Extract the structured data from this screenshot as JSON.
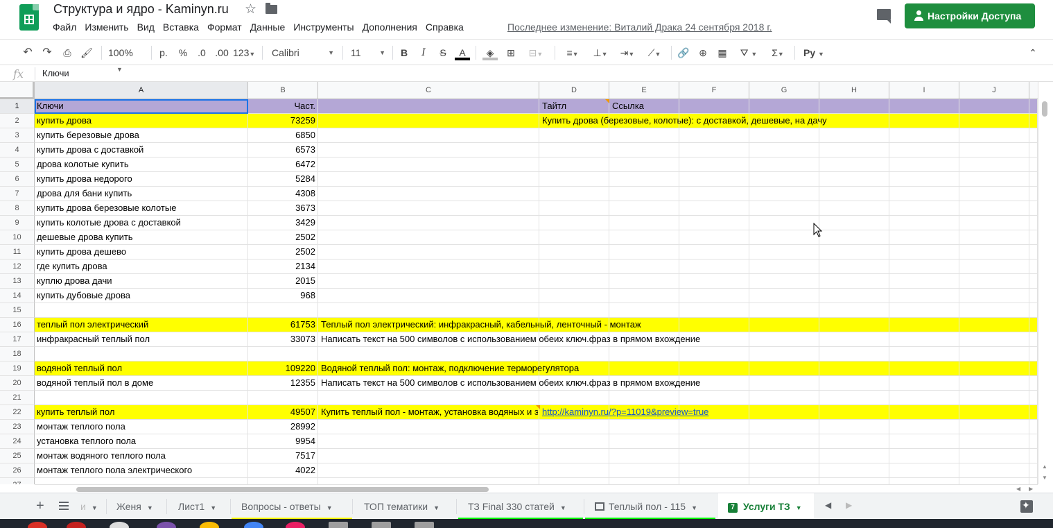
{
  "doc": {
    "title": "Структура и ядро - Kaminyn.ru",
    "last_edit": "Последнее изменение: Виталий Драка 24 сентября 2018 г.",
    "share_label": "Настройки Доступа"
  },
  "menu": [
    "Файл",
    "Изменить",
    "Вид",
    "Вставка",
    "Формат",
    "Данные",
    "Инструменты",
    "Дополнения",
    "Справка"
  ],
  "toolbar": {
    "zoom": "100%",
    "currency": "р.",
    "percent": "%",
    "dec_less": ".0",
    "dec_more": ".00",
    "more_formats": "123",
    "font": "Calibri",
    "font_size": "11",
    "bold": "B",
    "italic": "I",
    "strike": "S",
    "text_color": "A",
    "input_tools": "Pу",
    "text_color_value": "#000000",
    "fill_color_value": "#bdbdbd"
  },
  "formula": {
    "fx": "fx",
    "value": "Ключи"
  },
  "columns": [
    "A",
    "B",
    "C",
    "D",
    "E",
    "F",
    "G",
    "H",
    "I",
    "J"
  ],
  "rows": [
    {
      "n": "1",
      "style": "purple",
      "a": "Ключи",
      "b": "Част.",
      "c": "",
      "d": "Тайтл",
      "e": "Ссылка"
    },
    {
      "n": "2",
      "style": "yellow",
      "a": "купить дрова",
      "b": "73259",
      "c": "",
      "d": "Купить дрова (березовые, колотые): с доставкой, дешевые, на дачу",
      "e": ""
    },
    {
      "n": "3",
      "style": "",
      "a": "купить березовые дрова",
      "b": "6850",
      "c": "",
      "d": "",
      "e": ""
    },
    {
      "n": "4",
      "style": "",
      "a": "купить дрова с доставкой",
      "b": "6573",
      "c": "",
      "d": "",
      "e": ""
    },
    {
      "n": "5",
      "style": "",
      "a": "дрова колотые купить",
      "b": "6472",
      "c": "",
      "d": "",
      "e": ""
    },
    {
      "n": "6",
      "style": "",
      "a": "купить дрова недорого",
      "b": "5284",
      "c": "",
      "d": "",
      "e": ""
    },
    {
      "n": "7",
      "style": "",
      "a": "дрова для бани купить",
      "b": "4308",
      "c": "",
      "d": "",
      "e": ""
    },
    {
      "n": "8",
      "style": "",
      "a": "купить дрова березовые колотые",
      "b": "3673",
      "c": "",
      "d": "",
      "e": ""
    },
    {
      "n": "9",
      "style": "",
      "a": "купить колотые дрова с доставкой",
      "b": "3429",
      "c": "",
      "d": "",
      "e": ""
    },
    {
      "n": "10",
      "style": "",
      "a": "дешевые дрова купить",
      "b": "2502",
      "c": "",
      "d": "",
      "e": ""
    },
    {
      "n": "11",
      "style": "",
      "a": "купить дрова дешево",
      "b": "2502",
      "c": "",
      "d": "",
      "e": ""
    },
    {
      "n": "12",
      "style": "",
      "a": "где купить дрова",
      "b": "2134",
      "c": "",
      "d": "",
      "e": ""
    },
    {
      "n": "13",
      "style": "",
      "a": "куплю дрова дачи",
      "b": "2015",
      "c": "",
      "d": "",
      "e": ""
    },
    {
      "n": "14",
      "style": "",
      "a": "купить дубовые дрова",
      "b": "968",
      "c": "",
      "d": "",
      "e": ""
    },
    {
      "n": "15",
      "style": "",
      "a": "",
      "b": "",
      "c": "",
      "d": "",
      "e": ""
    },
    {
      "n": "16",
      "style": "yellow",
      "a": "теплый пол электрический",
      "b": "61753",
      "c": "Теплый пол электрический: инфракрасный, кабельный, ленточный - монтаж",
      "d": "",
      "e": ""
    },
    {
      "n": "17",
      "style": "",
      "a": "инфракрасный теплый пол",
      "b": "33073",
      "c": "Написать текст на 500 символов с использованием обеих ключ.фраз в прямом вхождение",
      "d": "",
      "e": ""
    },
    {
      "n": "18",
      "style": "",
      "a": "",
      "b": "",
      "c": "",
      "d": "",
      "e": ""
    },
    {
      "n": "19",
      "style": "yellow",
      "a": "водяной теплый пол",
      "b": "109220",
      "c": "Водяной теплый пол: монтаж, подключение терморегулятора",
      "d": "",
      "e": ""
    },
    {
      "n": "20",
      "style": "",
      "a": "водяной теплый пол в доме",
      "b": "12355",
      "c": "Написать текст на 500 символов с использованием обеих ключ.фраз в прямом вхождение",
      "d": "",
      "e": ""
    },
    {
      "n": "21",
      "style": "",
      "a": "",
      "b": "",
      "c": "",
      "d": "",
      "e": ""
    },
    {
      "n": "22",
      "style": "yellow",
      "a": "купить теплый пол",
      "b": "49507",
      "c": "Купить теплый пол - монтаж, установка водяных и э",
      "d": "http://kaminyn.ru/?p=11019&preview=true",
      "e": ""
    },
    {
      "n": "23",
      "style": "",
      "a": "монтаж теплого пола",
      "b": "28992",
      "c": "",
      "d": "",
      "e": ""
    },
    {
      "n": "24",
      "style": "",
      "a": "установка теплого пола",
      "b": "9954",
      "c": "",
      "d": "",
      "e": ""
    },
    {
      "n": "25",
      "style": "",
      "a": "монтаж водяного теплого пола",
      "b": "7517",
      "c": "",
      "d": "",
      "e": ""
    },
    {
      "n": "26",
      "style": "",
      "a": "монтаж теплого пола электрического",
      "b": "4022",
      "c": "",
      "d": "",
      "e": ""
    },
    {
      "n": "27",
      "style": "",
      "a": "",
      "b": "",
      "c": "",
      "d": "",
      "e": ""
    }
  ],
  "tabs": [
    {
      "label": "Женя",
      "badge": ""
    },
    {
      "label": "Лист1",
      "badge": ""
    },
    {
      "label": "Вопросы - ответы",
      "badge": ""
    },
    {
      "label": "ТОП тематики",
      "badge": ""
    },
    {
      "label": "ТЗ Final 330 статей",
      "badge": ""
    },
    {
      "label": "Теплый пол - 115",
      "badge": ""
    },
    {
      "label": "Услуги ТЗ",
      "badge": "7"
    }
  ],
  "colors": {
    "yellow": "#ffff00",
    "purple": "#b4a7d6",
    "tab_vopros": "#ffff00",
    "tab_tz": "#00ff00",
    "tab_teply": "#00ff00",
    "share": "#1e8e3e"
  }
}
